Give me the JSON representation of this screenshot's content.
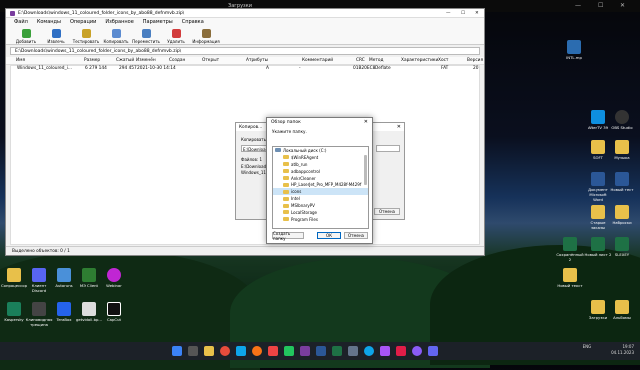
{
  "top_window": {
    "title": "Загрузки"
  },
  "winrar": {
    "title": "E:\\Downloads\\windows_11_coloured_folder_icons_by_abo88_defnmvb.zip\\",
    "menu": [
      "Файл",
      "Команды",
      "Операции",
      "Избранное",
      "Параметры",
      "Справка"
    ],
    "toolbar": [
      "Добавить",
      "Извлечь",
      "Тестировать",
      "Копировать",
      "Переместить",
      "Удалить",
      "Информация"
    ],
    "path": "E:\\Downloads\\windows_11_coloured_folder_icons_by_abo88_defnmvb.zip\\",
    "columns": [
      "Имя",
      "Размер",
      "Сжатый",
      "Изменён",
      "Создан",
      "Открыт",
      "Атрибуты",
      "Комментарий",
      "CRC",
      "Метод",
      "Характеристики",
      "Хост",
      "Версия"
    ],
    "row": {
      "name": "Windows_11_coloured_i...",
      "size": "6 279 144",
      "packed": "294 457",
      "modified": "2021-10-30 14:14",
      "attrs": "A",
      "comment": "-",
      "crc": "01B20EC8",
      "method": "Deflate",
      "host": "FAT",
      "version": "20"
    },
    "status": "Выделено объектов: 0 / 1"
  },
  "extract_dialog": {
    "title": "Копиров...",
    "label_copy": "Копировать в",
    "path": "E:\\Downloads\\",
    "files_label": "Файлов: 1",
    "file_name": "E:\\Downloads\\windows_11_...",
    "file_name2": "Windows_11_...",
    "cancel": "Отмена"
  },
  "browse": {
    "title": "Обзор папок",
    "instruction": "Укажите папку.",
    "tree": [
      "Локальный диск (C:)",
      "$WinREAgent",
      "atlb_run",
      "adbappcontrol",
      "AnkrCleaner",
      "HP_LaserJet_Pro_MFP_M428f-M429f",
      "icons",
      "Intel",
      "MSIbnaryPV",
      "LocalStorage",
      "Program Files"
    ],
    "create_button": "Создать папку",
    "ok": "ОК",
    "cancel": "Отмена"
  },
  "desktop_icons": {
    "right": [
      "INTL.mp",
      "AfterTV 39",
      "OBS Studio",
      "SOFT",
      "Музыка",
      "Документ Microsoft Word",
      "Новый тест",
      "Старые заказы",
      "Сохранённый 2",
      "Наброски",
      "Новый лист 2",
      "Новый текст",
      "SLEXEY",
      "Загрузки",
      "Альбомы"
    ],
    "left": [
      "Сопроцессор",
      "Клиент Discord",
      "Autoruns",
      "МЭ Client",
      "Webinar",
      "Kaspersky",
      "Клиновидная трещина",
      "TeraBox",
      "getvidoll.bp...",
      "CapCut"
    ]
  },
  "tray": {
    "lang": "ENG",
    "time": "19:07",
    "date": "04.11.2023"
  }
}
